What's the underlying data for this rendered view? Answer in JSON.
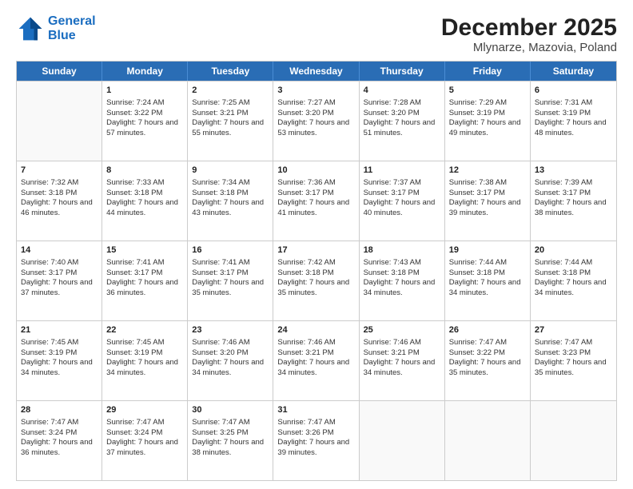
{
  "header": {
    "logo_line1": "General",
    "logo_line2": "Blue",
    "title": "December 2025",
    "subtitle": "Mlynarze, Mazovia, Poland"
  },
  "days_of_week": [
    "Sunday",
    "Monday",
    "Tuesday",
    "Wednesday",
    "Thursday",
    "Friday",
    "Saturday"
  ],
  "weeks": [
    [
      {
        "day": "",
        "empty": true
      },
      {
        "day": "1",
        "sunrise": "7:24 AM",
        "sunset": "3:22 PM",
        "daylight": "7 hours and 57 minutes."
      },
      {
        "day": "2",
        "sunrise": "7:25 AM",
        "sunset": "3:21 PM",
        "daylight": "7 hours and 55 minutes."
      },
      {
        "day": "3",
        "sunrise": "7:27 AM",
        "sunset": "3:20 PM",
        "daylight": "7 hours and 53 minutes."
      },
      {
        "day": "4",
        "sunrise": "7:28 AM",
        "sunset": "3:20 PM",
        "daylight": "7 hours and 51 minutes."
      },
      {
        "day": "5",
        "sunrise": "7:29 AM",
        "sunset": "3:19 PM",
        "daylight": "7 hours and 49 minutes."
      },
      {
        "day": "6",
        "sunrise": "7:31 AM",
        "sunset": "3:19 PM",
        "daylight": "7 hours and 48 minutes."
      }
    ],
    [
      {
        "day": "7",
        "sunrise": "7:32 AM",
        "sunset": "3:18 PM",
        "daylight": "7 hours and 46 minutes."
      },
      {
        "day": "8",
        "sunrise": "7:33 AM",
        "sunset": "3:18 PM",
        "daylight": "7 hours and 44 minutes."
      },
      {
        "day": "9",
        "sunrise": "7:34 AM",
        "sunset": "3:18 PM",
        "daylight": "7 hours and 43 minutes."
      },
      {
        "day": "10",
        "sunrise": "7:36 AM",
        "sunset": "3:17 PM",
        "daylight": "7 hours and 41 minutes."
      },
      {
        "day": "11",
        "sunrise": "7:37 AM",
        "sunset": "3:17 PM",
        "daylight": "7 hours and 40 minutes."
      },
      {
        "day": "12",
        "sunrise": "7:38 AM",
        "sunset": "3:17 PM",
        "daylight": "7 hours and 39 minutes."
      },
      {
        "day": "13",
        "sunrise": "7:39 AM",
        "sunset": "3:17 PM",
        "daylight": "7 hours and 38 minutes."
      }
    ],
    [
      {
        "day": "14",
        "sunrise": "7:40 AM",
        "sunset": "3:17 PM",
        "daylight": "7 hours and 37 minutes."
      },
      {
        "day": "15",
        "sunrise": "7:41 AM",
        "sunset": "3:17 PM",
        "daylight": "7 hours and 36 minutes."
      },
      {
        "day": "16",
        "sunrise": "7:41 AM",
        "sunset": "3:17 PM",
        "daylight": "7 hours and 35 minutes."
      },
      {
        "day": "17",
        "sunrise": "7:42 AM",
        "sunset": "3:18 PM",
        "daylight": "7 hours and 35 minutes."
      },
      {
        "day": "18",
        "sunrise": "7:43 AM",
        "sunset": "3:18 PM",
        "daylight": "7 hours and 34 minutes."
      },
      {
        "day": "19",
        "sunrise": "7:44 AM",
        "sunset": "3:18 PM",
        "daylight": "7 hours and 34 minutes."
      },
      {
        "day": "20",
        "sunrise": "7:44 AM",
        "sunset": "3:18 PM",
        "daylight": "7 hours and 34 minutes."
      }
    ],
    [
      {
        "day": "21",
        "sunrise": "7:45 AM",
        "sunset": "3:19 PM",
        "daylight": "7 hours and 34 minutes."
      },
      {
        "day": "22",
        "sunrise": "7:45 AM",
        "sunset": "3:19 PM",
        "daylight": "7 hours and 34 minutes."
      },
      {
        "day": "23",
        "sunrise": "7:46 AM",
        "sunset": "3:20 PM",
        "daylight": "7 hours and 34 minutes."
      },
      {
        "day": "24",
        "sunrise": "7:46 AM",
        "sunset": "3:21 PM",
        "daylight": "7 hours and 34 minutes."
      },
      {
        "day": "25",
        "sunrise": "7:46 AM",
        "sunset": "3:21 PM",
        "daylight": "7 hours and 34 minutes."
      },
      {
        "day": "26",
        "sunrise": "7:47 AM",
        "sunset": "3:22 PM",
        "daylight": "7 hours and 35 minutes."
      },
      {
        "day": "27",
        "sunrise": "7:47 AM",
        "sunset": "3:23 PM",
        "daylight": "7 hours and 35 minutes."
      }
    ],
    [
      {
        "day": "28",
        "sunrise": "7:47 AM",
        "sunset": "3:24 PM",
        "daylight": "7 hours and 36 minutes."
      },
      {
        "day": "29",
        "sunrise": "7:47 AM",
        "sunset": "3:24 PM",
        "daylight": "7 hours and 37 minutes."
      },
      {
        "day": "30",
        "sunrise": "7:47 AM",
        "sunset": "3:25 PM",
        "daylight": "7 hours and 38 minutes."
      },
      {
        "day": "31",
        "sunrise": "7:47 AM",
        "sunset": "3:26 PM",
        "daylight": "7 hours and 39 minutes."
      },
      {
        "day": "",
        "empty": true
      },
      {
        "day": "",
        "empty": true
      },
      {
        "day": "",
        "empty": true
      }
    ]
  ],
  "labels": {
    "sunrise": "Sunrise:",
    "sunset": "Sunset:",
    "daylight": "Daylight:"
  }
}
